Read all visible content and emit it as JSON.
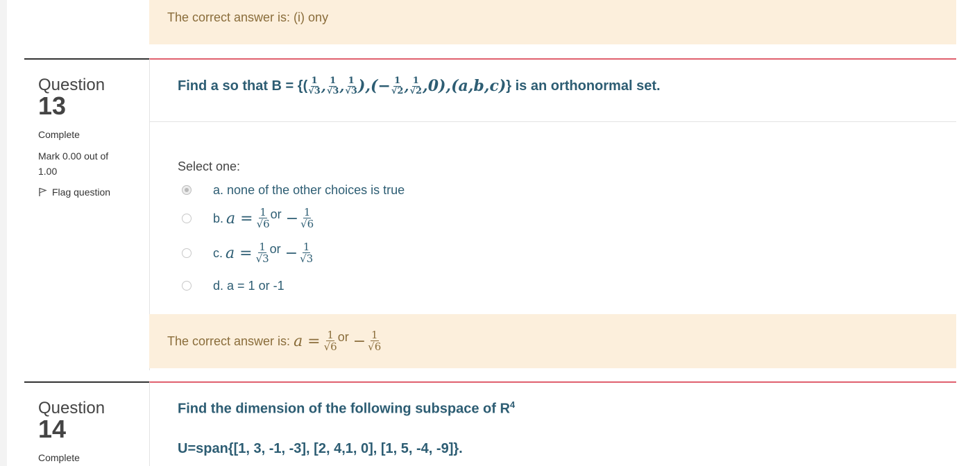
{
  "prev_feedback": {
    "text": "The correct answer is: (i) ony"
  },
  "q13": {
    "label": "Question",
    "number": "13",
    "state": "Complete",
    "grade": "Mark 0.00 out of 1.00",
    "flag": "Flag question",
    "text_prefix": "Find a so that B = {(",
    "text_suffix": "} is an orthonormal set.",
    "prompt": "Select one:",
    "options": [
      {
        "letter": "a.",
        "text": "none of the other choices is true",
        "selected": true
      },
      {
        "letter": "b.",
        "frac_den": "√6",
        "or_text": "or",
        "selected": false
      },
      {
        "letter": "c.",
        "frac_den": "√3",
        "or_text": "or",
        "selected": false
      },
      {
        "letter": "d.",
        "text": "a = 1 or -1",
        "selected": false
      }
    ],
    "feedback_prefix": "The correct answer is: ",
    "feedback_or": "or",
    "feedback_den": "√6"
  },
  "q14": {
    "label": "Question",
    "number": "14",
    "state": "Complete",
    "text_line1": "Find the dimension of the following subspace of R",
    "text_line1_sup": "4",
    "text_line2": "U=span{[1, 3, -1, -3], [2, 4,1, 0], [1, 5, -4, -9]}."
  },
  "colors": {
    "feedback_bg": "#fcefdc",
    "feedback_text": "#8a6d3b",
    "question_text": "#2d5d73",
    "content_border": "#e0606e"
  }
}
